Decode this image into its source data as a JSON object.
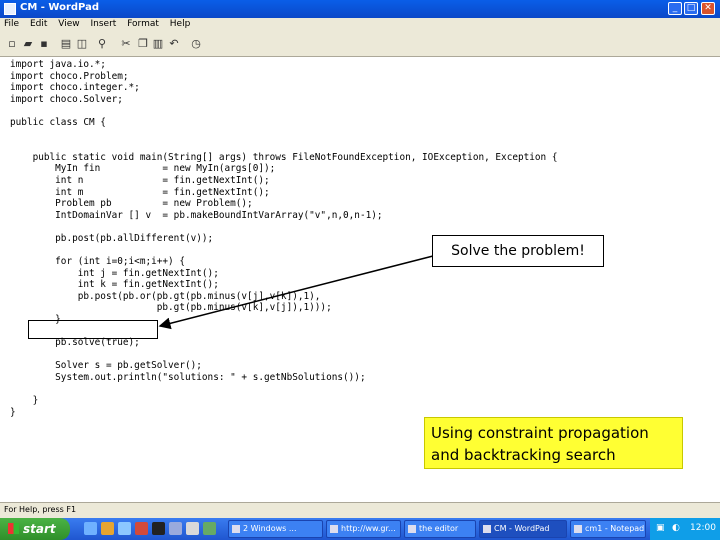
{
  "window": {
    "title": "CM - WordPad",
    "minimize": "_",
    "maximize": "□",
    "close": "✕"
  },
  "menu": [
    "File",
    "Edit",
    "View",
    "Insert",
    "Format",
    "Help"
  ],
  "toolbar": {
    "buttons": [
      "new-icon",
      "open-icon",
      "save-icon",
      "print-icon",
      "print-preview-icon",
      "find-icon",
      "cut-icon",
      "copy-icon",
      "paste-icon",
      "undo-icon",
      "date-time-icon"
    ]
  },
  "document": {
    "code": "import java.io.*;\nimport choco.Problem;\nimport choco.integer.*;\nimport choco.Solver;\n\npublic class CM {\n\n\n    public static void main(String[] args) throws FileNotFoundException, IOException, Exception {\n        MyIn fin           = new MyIn(args[0]);\n        int n              = fin.getNextInt();\n        int m              = fin.getNextInt();\n        Problem pb         = new Problem();\n        IntDomainVar [] v  = pb.makeBoundIntVarArray(\"v\",n,0,n-1);\n\n        pb.post(pb.allDifferent(v));\n\n        for (int i=0;i<m;i++) {\n            int j = fin.getNextInt();\n            int k = fin.getNextInt();\n            pb.post(pb.or(pb.gt(pb.minus(v[j],v[k]),1),\n                          pb.gt(pb.minus(v[k],v[j]),1)));\n        }\n\n        pb.solve(true);\n\n        Solver s = pb.getSolver();\n        System.out.println(\"solutions: \" + s.getNbSolutions());\n\n    }\n}"
  },
  "callouts": {
    "solve": "Solve the problem!",
    "using": "Using constraint propagation and backtracking search"
  },
  "status": {
    "text": "For Help, press F1"
  },
  "taskbar": {
    "start": "start",
    "tasks": [
      "2 Windows ...",
      "http://ww.gr...",
      "the editor",
      "CM - WordPad",
      "cm1 - Notepad"
    ],
    "active_task_index": 3,
    "clock": "12:00"
  }
}
